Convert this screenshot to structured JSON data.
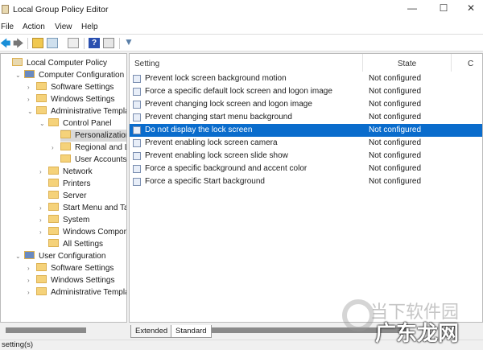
{
  "window": {
    "title": "Local Group Policy Editor",
    "minimize": "—",
    "maximize": "☐",
    "close": "✕"
  },
  "menu": [
    "File",
    "Action",
    "View",
    "Help"
  ],
  "tree": [
    {
      "label": "Local Computer Policy",
      "level": 0,
      "arrow": ""
    },
    {
      "label": "Computer Configuration",
      "level": 1,
      "arrow": "⌄"
    },
    {
      "label": "Software Settings",
      "level": 2,
      "arrow": "›"
    },
    {
      "label": "Windows Settings",
      "level": 2,
      "arrow": "›"
    },
    {
      "label": "Administrative Templates",
      "level": 2,
      "arrow": "⌄"
    },
    {
      "label": "Control Panel",
      "level": 3,
      "arrow": "⌄"
    },
    {
      "label": "Personalization",
      "level": 4,
      "arrow": "",
      "selected": true
    },
    {
      "label": "Regional and Lang",
      "level": 4,
      "arrow": "›"
    },
    {
      "label": "User Accounts",
      "level": 4,
      "arrow": ""
    },
    {
      "label": "Network",
      "level": 3,
      "arrow": "›"
    },
    {
      "label": "Printers",
      "level": 3,
      "arrow": ""
    },
    {
      "label": "Server",
      "level": 3,
      "arrow": ""
    },
    {
      "label": "Start Menu and Taskba",
      "level": 3,
      "arrow": "›"
    },
    {
      "label": "System",
      "level": 3,
      "arrow": "›"
    },
    {
      "label": "Windows Components",
      "level": 3,
      "arrow": "›"
    },
    {
      "label": "All Settings",
      "level": 3,
      "arrow": ""
    },
    {
      "label": "User Configuration",
      "level": 1,
      "arrow": "⌄"
    },
    {
      "label": "Software Settings",
      "level": 2,
      "arrow": "›"
    },
    {
      "label": "Windows Settings",
      "level": 2,
      "arrow": "›"
    },
    {
      "label": "Administrative Templates",
      "level": 2,
      "arrow": "›"
    }
  ],
  "columns": {
    "setting": "Setting",
    "state": "State",
    "comment": "C"
  },
  "settings": [
    {
      "name": "Prevent lock screen background motion",
      "state": "Not configured"
    },
    {
      "name": "Force a specific default lock screen and logon image",
      "state": "Not configured"
    },
    {
      "name": "Prevent changing lock screen and logon image",
      "state": "Not configured"
    },
    {
      "name": "Prevent changing start menu background",
      "state": "Not configured"
    },
    {
      "name": "Do not display the lock screen",
      "state": "Not configured",
      "selected": true
    },
    {
      "name": "Prevent enabling lock screen camera",
      "state": "Not configured"
    },
    {
      "name": "Prevent enabling lock screen slide show",
      "state": "Not configured"
    },
    {
      "name": "Force a specific background and accent color",
      "state": "Not configured"
    },
    {
      "name": "Force a specific Start background",
      "state": "Not configured"
    }
  ],
  "tabs": [
    "Extended",
    "Standard"
  ],
  "status": "setting(s)",
  "watermark": {
    "top": "当下软件园",
    "bottom": "广东龙网"
  },
  "colors": {
    "selection": "#0a6ccc",
    "folder": "#f5d27a"
  }
}
